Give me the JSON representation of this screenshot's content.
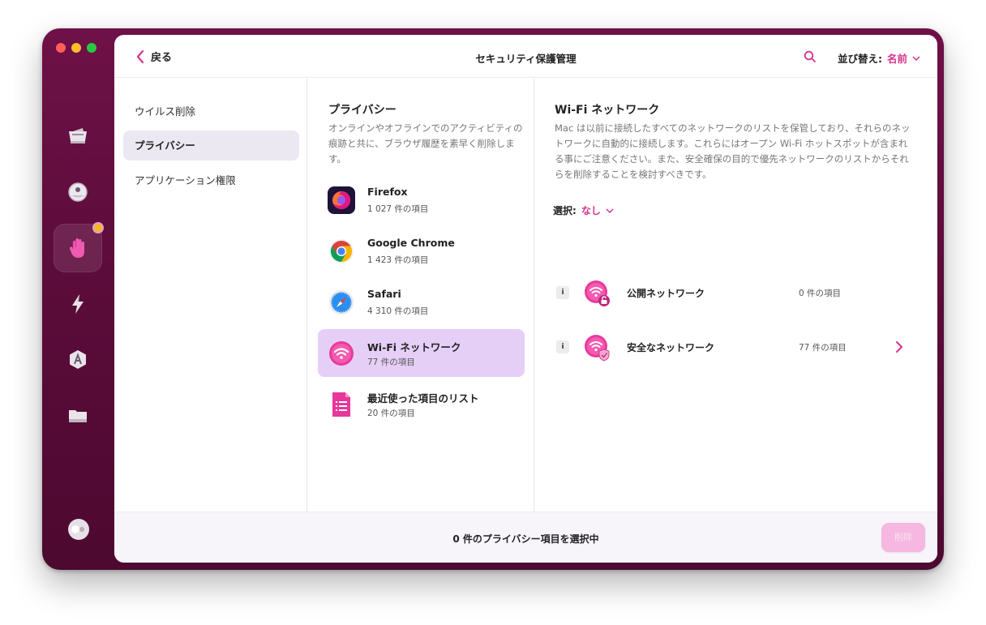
{
  "topbar": {
    "back_label": "戻る",
    "title": "セキュリティ保護管理",
    "sort_label": "並び替え:",
    "sort_value": "名前"
  },
  "sidebar_icons": [
    {
      "name": "system-junk-icon",
      "active": false
    },
    {
      "name": "malware-removal-icon",
      "active": false
    },
    {
      "name": "protection-hand-icon",
      "active": true
    },
    {
      "name": "speed-bolt-icon",
      "active": false
    },
    {
      "name": "applications-icon",
      "active": false
    },
    {
      "name": "files-folder-icon",
      "active": false
    }
  ],
  "nav": {
    "items": [
      {
        "label": "ウイルス削除",
        "selected": false
      },
      {
        "label": "プライバシー",
        "selected": true
      },
      {
        "label": "アプリケーション権限",
        "selected": false
      }
    ]
  },
  "privacy": {
    "title": "プライバシー",
    "description": "オンラインやオフラインでのアクティビティの痕跡と共に、ブラウザ履歴を素早く削除します。",
    "apps": [
      {
        "name": "Firefox",
        "count": "1 027 件の項目",
        "icon": "firefox-icon",
        "selected": false
      },
      {
        "name": "Google Chrome",
        "count": "1 423 件の項目",
        "icon": "chrome-icon",
        "selected": false
      },
      {
        "name": "Safari",
        "count": "4 310 件の項目",
        "icon": "safari-icon",
        "selected": false
      },
      {
        "name": "Wi-Fi ネットワーク",
        "count": "77 件の項目",
        "icon": "wifi-icon",
        "selected": true
      },
      {
        "name": "最近使った項目のリスト",
        "count": "20 件の項目",
        "icon": "recent-items-icon",
        "selected": false
      }
    ]
  },
  "detail": {
    "title": "Wi-Fi ネットワーク",
    "description": "Mac は以前に接続したすべてのネットワークのリストを保管しており、それらのネットワークに自動的に接続します。これらにはオープン Wi-Fi ホットスポットが含まれる事にご注意ください。また、安全確保の目的で優先ネットワークのリストからそれらを削除することを検討すべきです。",
    "select_label": "選択:",
    "select_value": "なし",
    "networks": [
      {
        "name": "公開ネットワーク",
        "count": "0 件の項目",
        "info": "i",
        "has_chevron": false
      },
      {
        "name": "安全なネットワーク",
        "count": "77 件の項目",
        "info": "i",
        "has_chevron": true
      }
    ]
  },
  "bottom": {
    "status": "0 件のプライバシー項目を選択中",
    "delete_label": "削除"
  },
  "colors": {
    "accent": "#d6338f",
    "window_bg": "#5c0c3a",
    "selected_row": "#e6cff7"
  }
}
